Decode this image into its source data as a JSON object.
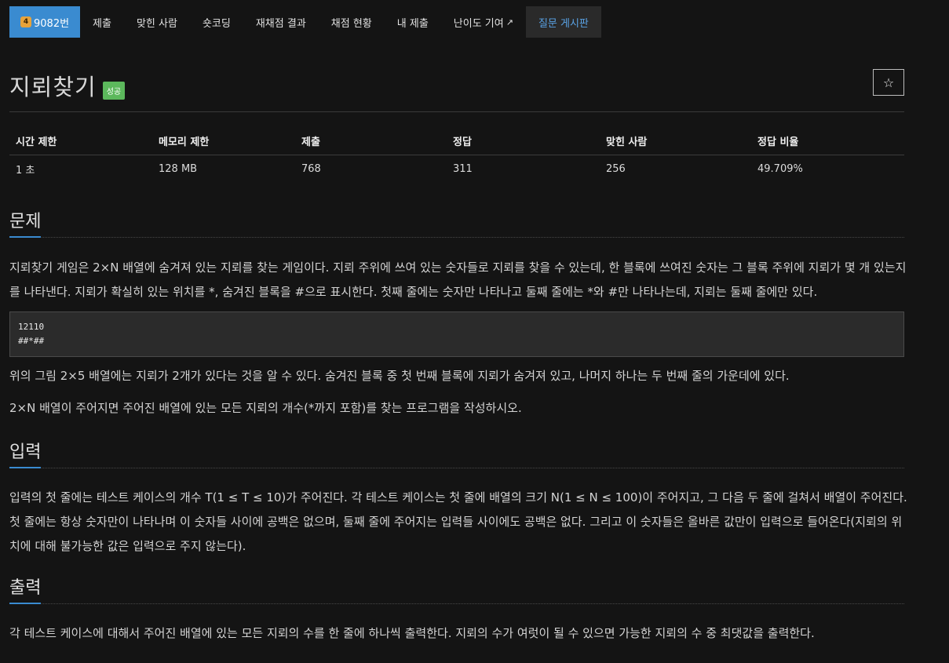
{
  "nav": {
    "problem_number": "9082번",
    "medal": "4",
    "items": [
      "제출",
      "맞힌 사람",
      "숏코딩",
      "재채점 결과",
      "채점 현황",
      "내 제출",
      "난이도 기여"
    ],
    "board": "질문 게시판",
    "ext_icon": "external-link-icon"
  },
  "problem": {
    "title": "지뢰찾기",
    "status_badge": "성공",
    "star_icon": "☆"
  },
  "info_table": {
    "headers": [
      "시간 제한",
      "메모리 제한",
      "제출",
      "정답",
      "맞힌 사람",
      "정답 비율"
    ],
    "values": [
      "1 초",
      "128 MB",
      "768",
      "311",
      "256",
      "49.709%"
    ]
  },
  "sections": {
    "problem_heading": "문제",
    "problem_text_1": "지뢰찾기 게임은 2×N 배열에 숨겨져 있는 지뢰를 찾는 게임이다. 지뢰 주위에 쓰여 있는 숫자들로 지뢰를 찾을 수 있는데, 한 블록에 쓰여진 숫자는 그 블록 주위에 지뢰가 몇 개 있는지를 나타낸다. 지뢰가 확실히 있는 위치를 *, 숨겨진 블록을 #으로 표시한다. 첫째 줄에는 숫자만 나타나고 둘째 줄에는 *와 #만 나타나는데, 지뢰는 둘째 줄에만 있다.",
    "code_example": "12110\n##*##",
    "problem_text_2": "위의 그림 2×5 배열에는 지뢰가 2개가 있다는 것을 알 수 있다. 숨겨진 블록 중 첫 번째 블록에 지뢰가 숨겨져 있고, 나머지 하나는 두 번째 줄의 가운데에 있다.",
    "problem_text_3": "2×N 배열이 주어지면 주어진 배열에 있는 모든 지뢰의 개수(*까지 포함)를 찾는 프로그램을 작성하시오.",
    "input_heading": "입력",
    "input_text": "입력의 첫 줄에는 테스트 케이스의 개수 T(1 ≤ T ≤ 10)가 주어진다. 각 테스트 케이스는 첫 줄에 배열의 크기 N(1 ≤ N ≤ 100)이 주어지고, 그 다음 두 줄에 걸쳐서 배열이 주어진다. 첫 줄에는 항상 숫자만이 나타나며 이 숫자들 사이에 공백은 없으며, 둘째 줄에 주어지는 입력들 사이에도 공백은 없다. 그리고 이 숫자들은 올바른 값만이 입력으로 들어온다(지뢰의 위치에 대해 불가능한 값은 입력으로 주지 않는다).",
    "output_heading": "출력",
    "output_text": "각 테스트 케이스에 대해서 주어진 배열에 있는 모든 지뢰의 수를 한 줄에 하나씩 출력한다. 지뢰의 수가 여럿이 될 수 있으면 가능한 지뢰의 수 중 최댓값을 출력한다."
  },
  "colors": {
    "accent": "#3a8bd0",
    "success": "#5cb85c",
    "background": "#141414"
  }
}
